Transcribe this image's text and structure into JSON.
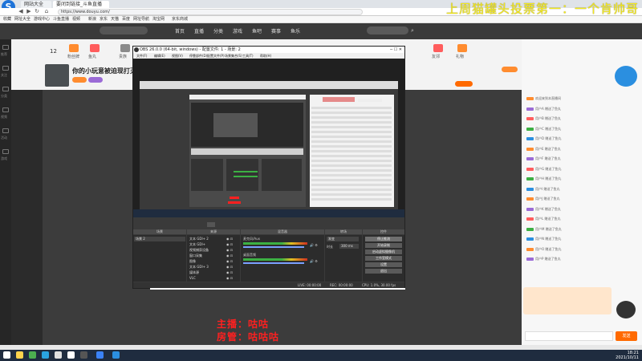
{
  "browser": {
    "logo": "S",
    "tabs": [
      {
        "label": "网站大全",
        "active": false
      },
      {
        "label": "要闭到链接_斗鱼直播",
        "active": true
      }
    ],
    "url": "https://www.douyu.com/",
    "bookmarks": [
      "收藏",
      "网址大全",
      "游戏中心",
      "斗鱼直播",
      "视频",
      "新浪",
      "京东",
      "天猫",
      "百度",
      "网址导航",
      "淘宝网",
      "京东商城"
    ]
  },
  "watermark": "上周猫罐头投票第一：一个肯帅哥",
  "site": {
    "nav": [
      "首页",
      "直播",
      "分类",
      "游戏",
      "鱼吧",
      "赛事",
      "鱼乐"
    ],
    "left_sidebar": [
      "推荐",
      "关注",
      "分类",
      "视频",
      "活动",
      "游戏"
    ]
  },
  "room": {
    "count": "12",
    "title": "你的小玩意被迫现打灭了",
    "top_labels": [
      "粉丝牌",
      "鱼丸",
      "贵族",
      "友邻",
      "礼物"
    ]
  },
  "obs": {
    "window_title": "OBS 26.0.0 (64-bit, windows) - 配置文件: 1 - 场景: 2",
    "menu": [
      "文件(F)",
      "编辑(E)",
      "视图(V)",
      "停靠部件(D)",
      "配置文件(P)",
      "场景集合(S)",
      "工具(T)",
      "帮助(H)"
    ],
    "docks": [
      "场景",
      "来源",
      "混音器",
      "转场",
      "控件"
    ],
    "scene_item": "场景 2",
    "sources": [
      "文本 GDI+ 2",
      "文本 GDI+",
      "视频捕获设备",
      "窗口采集",
      "图像",
      "文本 GDI+ 3",
      "媒体源",
      "VLC"
    ],
    "mixer": [
      "麦克风/Aux",
      "桌面音频"
    ],
    "transition": "渐变",
    "duration_label": "时长",
    "duration": "300 ms",
    "controls": [
      "停止推流",
      "开始录制",
      "启动虚拟摄像机",
      "工作室模式",
      "设置",
      "退出"
    ],
    "status": [
      "LIVE: 00:00:00",
      "REC: 00:00:00",
      "CPU: 1.0%, 30.00 fps"
    ]
  },
  "overlay_text": {
    "line1": "主播：咕咕",
    "line2": "房管：咕咕咕"
  },
  "chat": {
    "rows": [
      "欢迎来到本直播间",
      "用户A 赠送了鱼丸",
      "用户B 赠送了鱼丸",
      "用户C 赠送了鱼丸",
      "用户D 赠送了鱼丸",
      "用户E 赠送了鱼丸",
      "用户F 赠送了鱼丸",
      "用户G 赠送了鱼丸",
      "用户H 赠送了鱼丸",
      "用户I 赠送了鱼丸",
      "用户J 赠送了鱼丸",
      "用户K 赠送了鱼丸",
      "用户L 赠送了鱼丸",
      "用户M 赠送了鱼丸",
      "用户N 赠送了鱼丸",
      "用户O 赠送了鱼丸",
      "用户P 赠送了鱼丸"
    ],
    "send": "发送"
  },
  "taskbar": {
    "time": "18:21",
    "date": "2021/10/11"
  },
  "colors": {
    "accent": "#ff6a00",
    "overlay_red": "#ff2020",
    "watermark_yellow": "#f3e91b"
  }
}
